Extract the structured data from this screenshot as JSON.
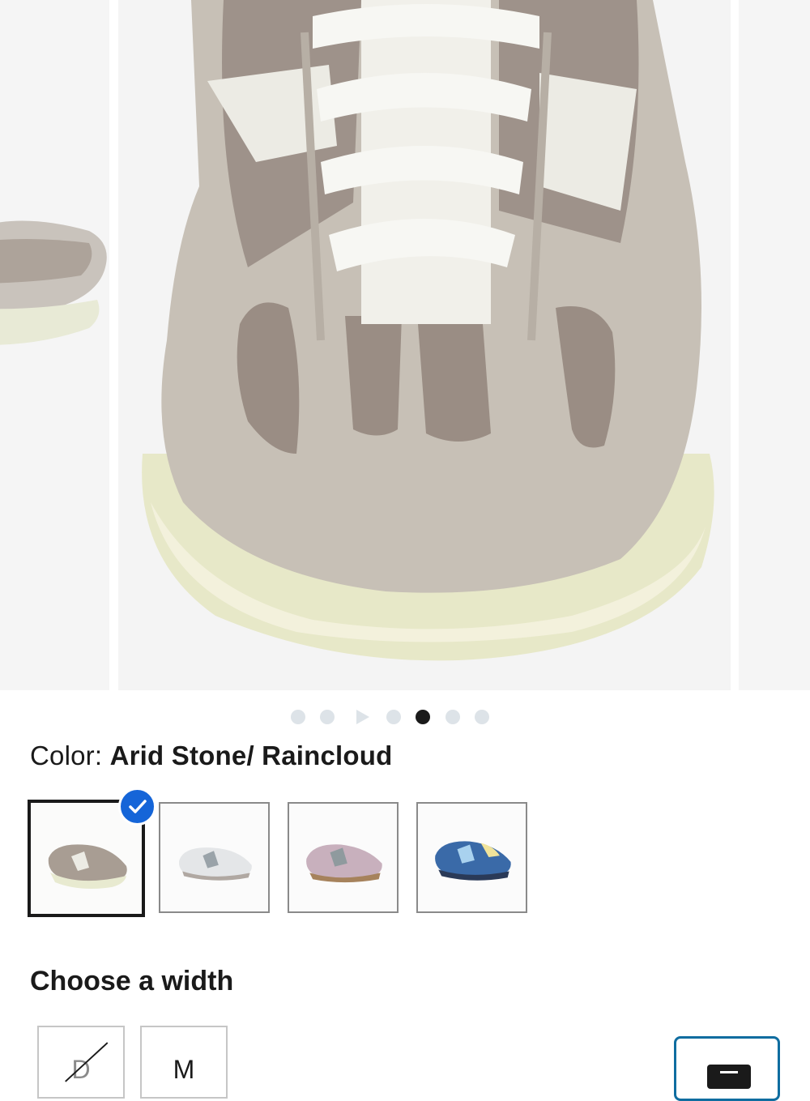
{
  "gallery": {
    "image_count": 7,
    "active_index": 4,
    "video_index": 2,
    "images": [
      "shoe-side-view",
      "shoe-front-view",
      "shoe-next-view"
    ]
  },
  "color": {
    "label": "Color:",
    "value": "Arid Stone/ Raincloud",
    "swatches": [
      {
        "name": "Arid Stone/ Raincloud",
        "selected": true,
        "tone": "#a89d93"
      },
      {
        "name": "white-grey",
        "selected": false,
        "tone": "#e4e6e8"
      },
      {
        "name": "pink-grey",
        "selected": false,
        "tone": "#c8b0bd"
      },
      {
        "name": "blue-navy",
        "selected": false,
        "tone": "#3a6aa8"
      }
    ]
  },
  "width": {
    "title": "Choose a width",
    "options": [
      {
        "label": "D",
        "available": false
      },
      {
        "label": "M",
        "available": true
      }
    ]
  },
  "icons": {
    "check": "check-icon",
    "play": "play-icon",
    "chat": "chat-icon"
  },
  "colors": {
    "accent_blue": "#1565d8",
    "chat_border": "#0f6da0",
    "dot_inactive": "#dde3e8",
    "dot_active": "#1a1a1a"
  }
}
